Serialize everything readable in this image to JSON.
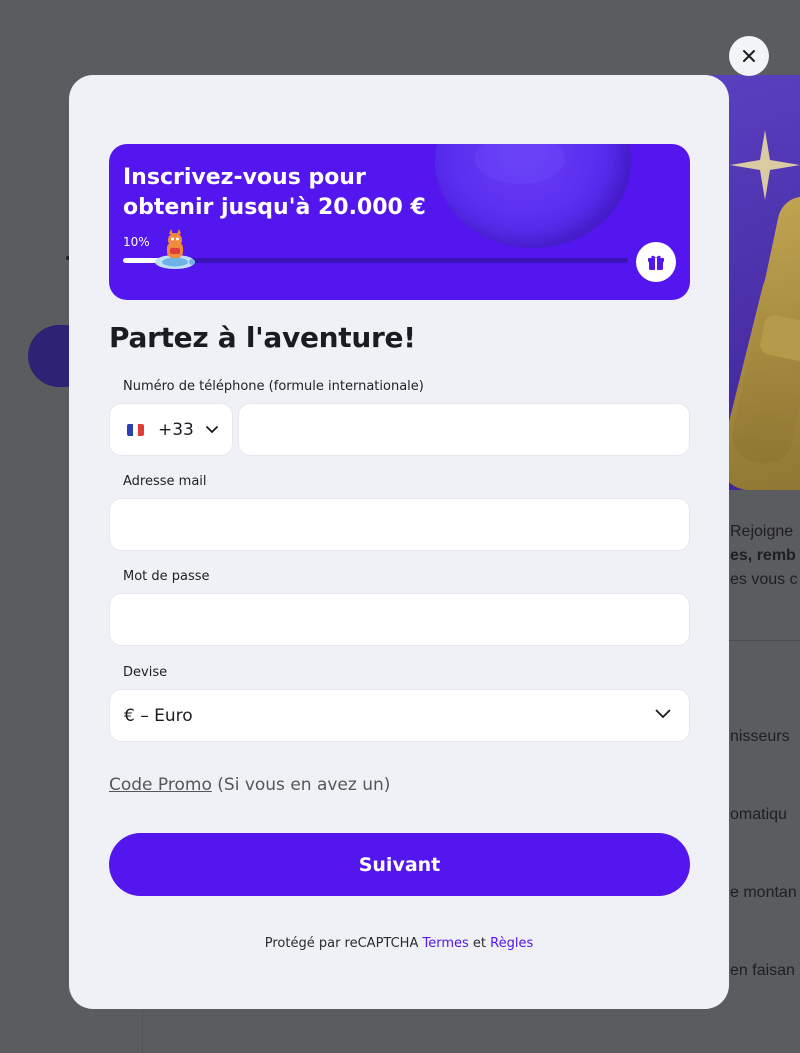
{
  "background": {
    "partial_lines": [
      "Rejoigne",
      "es, remb",
      "es vous c",
      "nisseurs",
      "omatiqu",
      "e montan",
      "en faisan"
    ]
  },
  "modal": {
    "banner": {
      "title": "Inscrivez-vous pour obtenir jusqu'à 20.000 €",
      "percent_label": "10%",
      "progress": 0.1,
      "gift_icon": "gift-icon"
    },
    "heading": "Partez à l'aventure!",
    "phone": {
      "label": "Numéro de téléphone (formule internationale)",
      "country_flag": "france-flag-icon",
      "country_code": "+33",
      "value": ""
    },
    "email": {
      "label": "Adresse mail",
      "value": ""
    },
    "password": {
      "label": "Mot de passe",
      "value": ""
    },
    "currency": {
      "label": "Devise",
      "value": "€ – Euro"
    },
    "promo": {
      "link": "Code Promo",
      "hint": "(Si vous en avez un)"
    },
    "submit_label": "Suivant",
    "legal": {
      "prefix": "Protégé par reCAPTCHA",
      "terms": "Termes",
      "and": "et",
      "rules": "Règles"
    }
  },
  "colors": {
    "primary": "#5316ee",
    "modal_bg": "#f0f1f6",
    "overlay": "#5b5c5f"
  }
}
